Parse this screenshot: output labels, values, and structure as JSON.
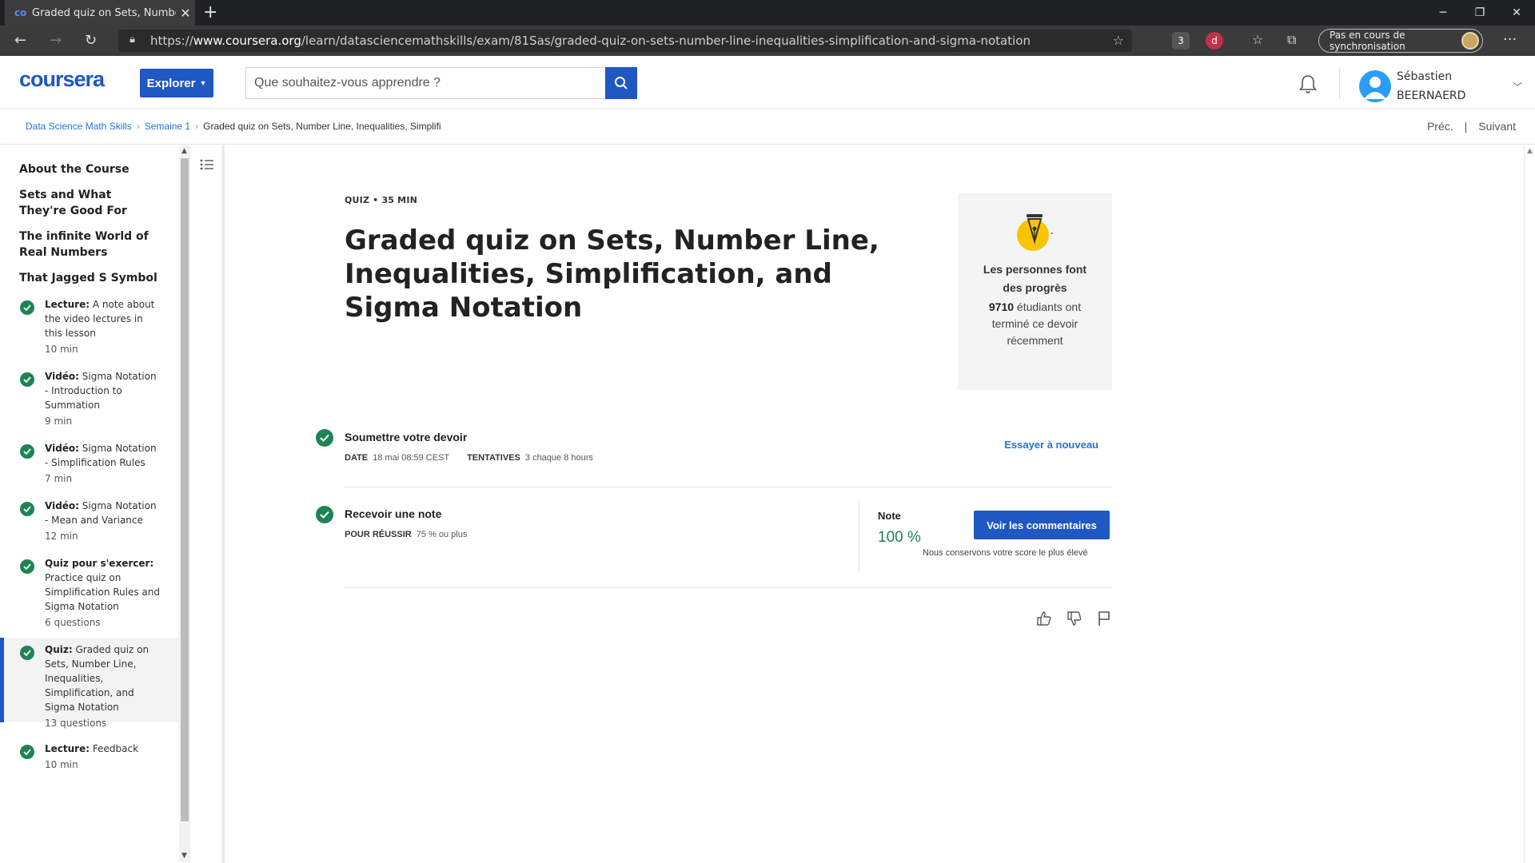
{
  "browser": {
    "tab_title": "Graded quiz on Sets, Number Lin",
    "tab_favicon": "co",
    "url_prefix": "https://",
    "url_host": "www.coursera.org",
    "url_path": "/learn/datasciencemathskills/exam/81Sas/graded-quiz-on-sets-number-line-inequalities-simplification-and-sigma-notation",
    "ext_badge": "3",
    "sync_label": "Pas en cours de synchronisation"
  },
  "header": {
    "logo": "coursera",
    "explore_label": "Explorer",
    "search_placeholder": "Que souhaitez-vous apprendre ?",
    "user_first": "Sébastien",
    "user_last": "BEERNAERD"
  },
  "breadcrumb": {
    "items": [
      "Data Science Math Skills",
      "Semaine 1",
      "Graded quiz on Sets, Number Line, Inequalities, Simplifi"
    ],
    "prev": "Préc.",
    "next": "Suivant"
  },
  "sidebar": {
    "sections": [
      "About the Course",
      "Sets and What They're Good For",
      "The infinite World of Real Numbers",
      "That Jagged S Symbol"
    ],
    "items": [
      {
        "type": "Lecture:",
        "label": "A note about the video lectures in this lesson",
        "meta": "10  min"
      },
      {
        "type": "Vidéo:",
        "label": "Sigma Notation - Introduction to Summation",
        "meta": "9  min"
      },
      {
        "type": "Vidéo:",
        "label": "Sigma Notation - Simplification Rules",
        "meta": "7  min"
      },
      {
        "type": "Vidéo:",
        "label": "Sigma Notation - Mean and Variance",
        "meta": "12  min"
      },
      {
        "type": "Quiz pour s'exercer:",
        "label": "Practice quiz on Simplification Rules and Sigma Notation",
        "meta": "6 questions"
      },
      {
        "type": "Quiz:",
        "label": "Graded quiz on Sets, Number Line, Inequalities, Simplification, and Sigma Notation",
        "meta": "13 questions"
      },
      {
        "type": "Lecture:",
        "label": "Feedback",
        "meta": "10  min"
      }
    ]
  },
  "main": {
    "kicker": "QUIZ • 35  MIN",
    "title": "Graded quiz on Sets, Number Line, Inequalities, Simplification, and Sigma Notation",
    "progress_card": {
      "title": "Les personnes font des progrès",
      "count": "9710",
      "body": " étudiants ont terminé ce devoir récemment"
    },
    "submit": {
      "title": "Soumettre votre devoir",
      "date_label": "DATE",
      "date_value": "18 mai 08:59 CEST",
      "attempts_label": "TENTATIVES",
      "attempts_value": "3 chaque 8  hours",
      "retry": "Essayer à nouveau"
    },
    "grade": {
      "title": "Recevoir une note",
      "pass_label": "POUR RÉUSSIR",
      "pass_value": "75 % ou plus",
      "note_label": "Note",
      "note_value": "100 %",
      "feedback_button": "Voir les commentaires",
      "keep_note": "Nous conservons votre score le plus élevé"
    }
  },
  "colors": {
    "brand_blue": "#1f57c3",
    "success_green": "#1f8354",
    "link_blue": "#2a73cc"
  },
  "icons": [
    "back-icon",
    "forward-icon",
    "reload-icon",
    "lock-icon",
    "star-icon",
    "search-icon",
    "bell-icon",
    "user-icon",
    "list-icon",
    "check-icon",
    "pen-nib-icon",
    "thumbs-up-icon",
    "thumbs-down-icon",
    "flag-icon"
  ]
}
